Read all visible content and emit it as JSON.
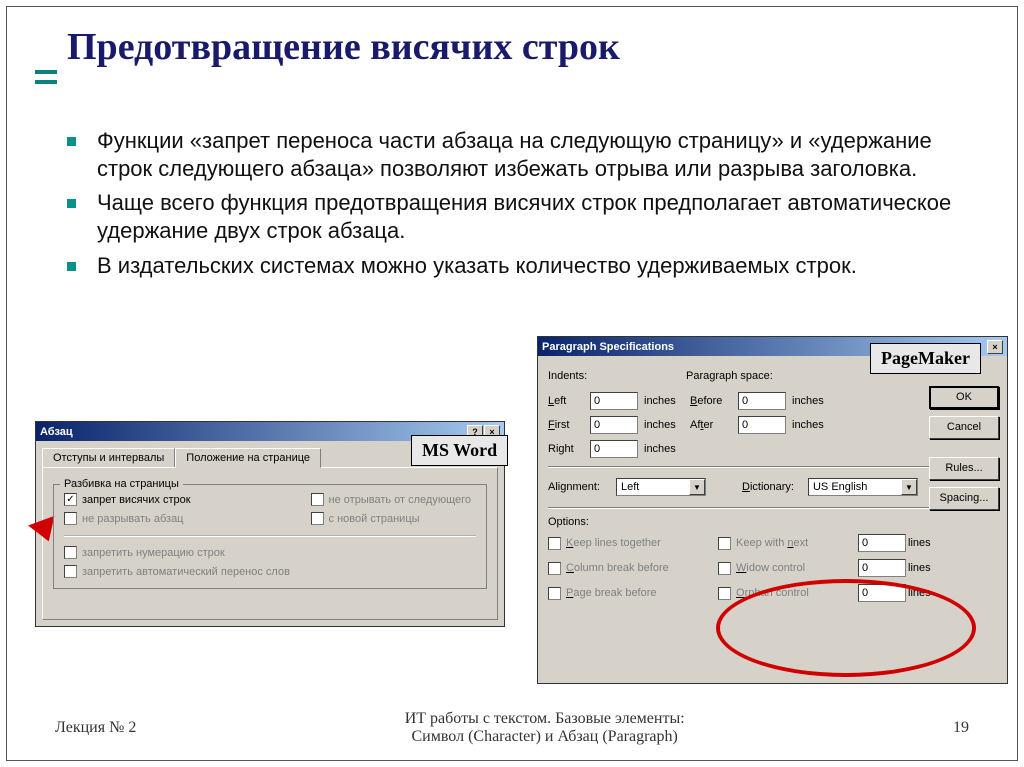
{
  "slide": {
    "title": "Предотвращение висячих строк",
    "bullets": [
      "Функции «запрет переноса части абзаца на следующую страницу» и «удержание строк следующего абзаца» позволяют избежать отрыва или разрыва заголовка.",
      "Чаще всего функция предотвращения висячих строк предполагает автоматическое удержание двух строк абзаца.",
      "В издательских системах можно указать количество удерживаемых строк."
    ]
  },
  "labels": {
    "msword": "MS Word",
    "pagemaker": "PageMaker"
  },
  "word": {
    "title": "Абзац",
    "tab_indents": "Отступы и интервалы",
    "tab_position": "Положение на странице",
    "group_break": "Разбивка на страницы",
    "chk_widow": "запрет висячих строк",
    "chk_keeppar": "не разрывать абзац",
    "chk_keepnext": "не отрывать от следующего",
    "chk_newpage": "с новой страницы",
    "chk_nolinenum": "запретить нумерацию строк",
    "chk_nohyphen": "запретить автоматический перенос слов"
  },
  "pm": {
    "title": "Paragraph Specifications",
    "indents": "Indents:",
    "paraspace": "Paragraph space:",
    "left": "Left",
    "first": "First",
    "right": "Right",
    "before": "Before",
    "after": "After",
    "inches": "inches",
    "alignment_lbl": "Alignment:",
    "alignment_val": "Left",
    "dictionary_lbl": "Dictionary:",
    "dictionary_val": "US English",
    "options": "Options:",
    "keep_together": "Keep lines together",
    "column_break": "Column break before",
    "page_break": "Page break before",
    "keep_with_next": "Keep with next",
    "widow_control": "Widow control",
    "orphan_control": "Orphan control",
    "lines": "lines",
    "val_zero": "0",
    "btn_ok": "OK",
    "btn_cancel": "Cancel",
    "btn_rules": "Rules...",
    "btn_spacing": "Spacing..."
  },
  "footer": {
    "left": "Лекция № 2",
    "center1": "ИТ работы с текстом. Базовые элементы:",
    "center2": "Символ (Character)  и Абзац (Paragraph)",
    "page": "19"
  }
}
